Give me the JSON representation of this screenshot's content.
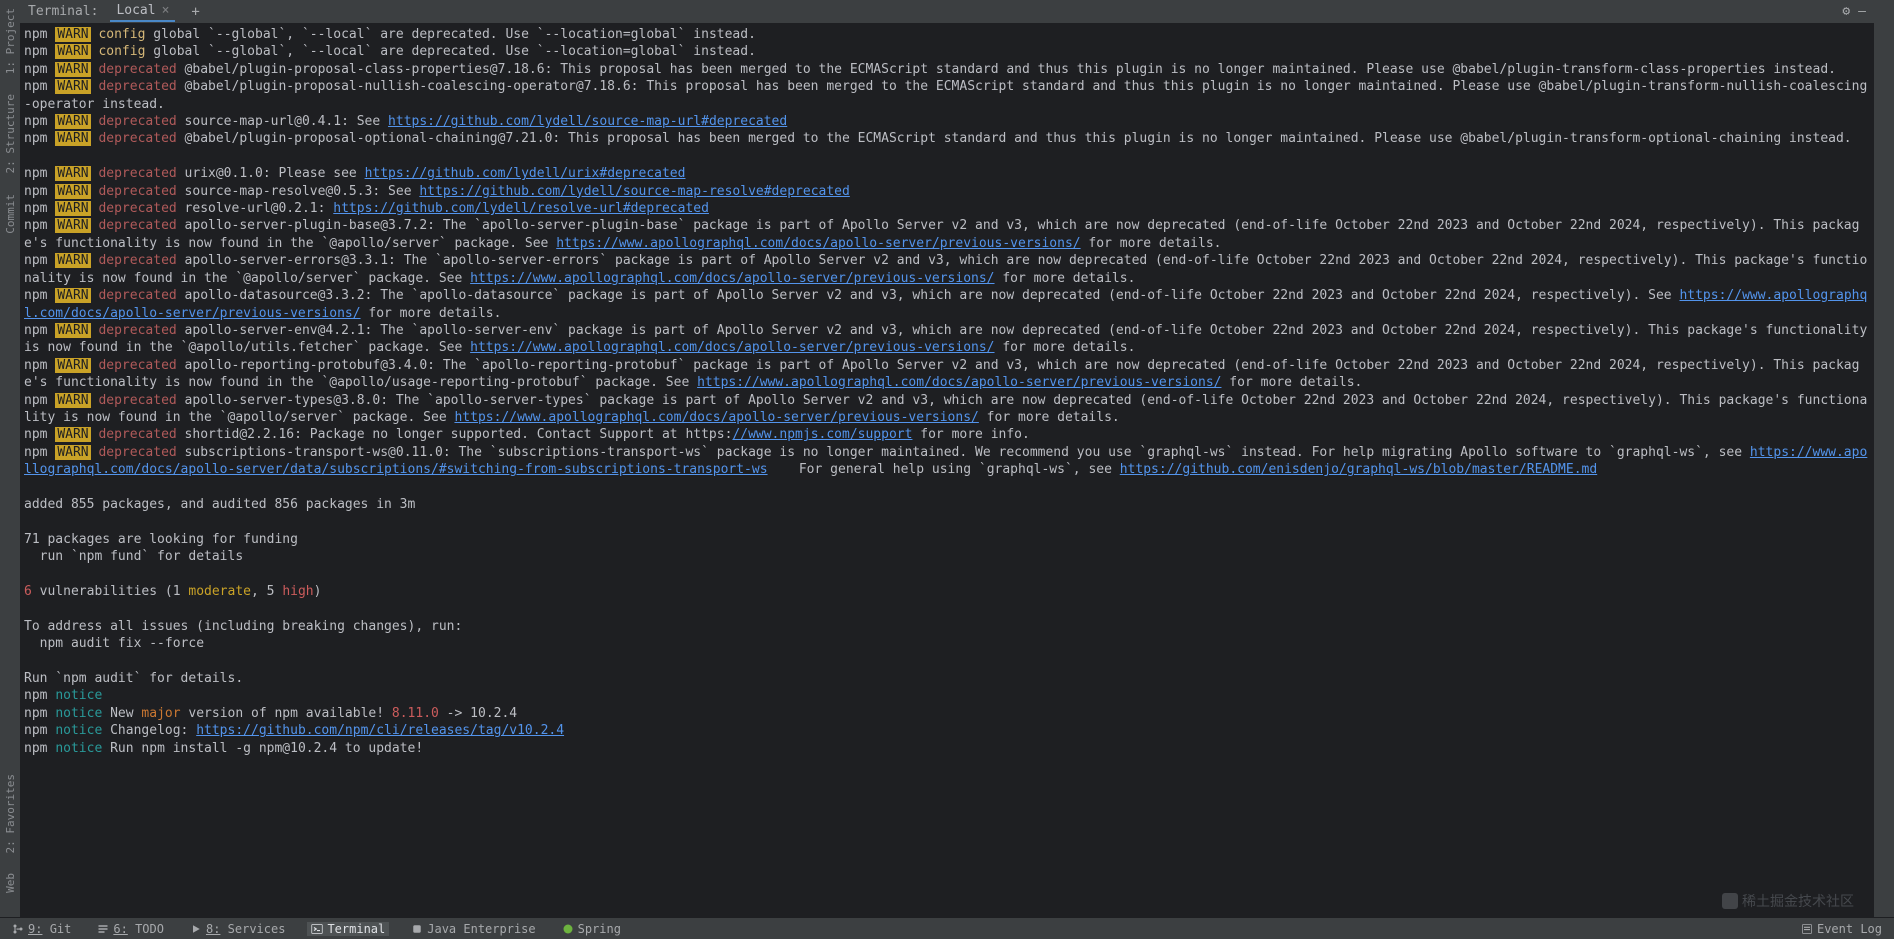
{
  "terminal": {
    "title": "Terminal:",
    "tab_label": "Local",
    "plus": "+"
  },
  "header_icons": {
    "gear": "⚙",
    "minimize": "—"
  },
  "left_gutter": {
    "project": "1: Project",
    "structure": "2: Structure",
    "commit": "Commit",
    "favorites": "2: Favorites",
    "web": "Web"
  },
  "lines": [
    [
      [
        "c-npm",
        "npm "
      ],
      [
        "c-warn-bg",
        "WARN"
      ],
      [
        "c-config",
        " config "
      ],
      [
        "",
        "global `--global`, `--local` are deprecated. Use `--location=global` instead."
      ]
    ],
    [
      [
        "c-npm",
        "npm "
      ],
      [
        "c-warn-bg",
        "WARN"
      ],
      [
        "c-config",
        " config "
      ],
      [
        "",
        "global `--global`, `--local` are deprecated. Use `--location=global` instead."
      ]
    ],
    [
      [
        "c-npm",
        "npm "
      ],
      [
        "c-warn-bg",
        "WARN"
      ],
      [
        "c-deprecated",
        " deprecated "
      ],
      [
        "",
        "@babel/plugin-proposal-class-properties@7.18.6: This proposal has been merged to the ECMAScript standard and thus this plugin is no longer maintained. Please use @babel/plugin-transform-class-properties instead."
      ]
    ],
    [
      [
        "c-npm",
        "npm "
      ],
      [
        "c-warn-bg",
        "WARN"
      ],
      [
        "c-deprecated",
        " deprecated "
      ],
      [
        "",
        "@babel/plugin-proposal-nullish-coalescing-operator@7.18.6: This proposal has been merged to the ECMAScript standard and thus this plugin is no longer maintained. Please use @babel/plugin-transform-nullish-coalescing-operator instead."
      ]
    ],
    [
      [
        "c-npm",
        "npm "
      ],
      [
        "c-warn-bg",
        "WARN"
      ],
      [
        "c-deprecated",
        " deprecated "
      ],
      [
        "",
        "source-map-url@0.4.1: See "
      ],
      [
        "link",
        "https://github.com/lydell/source-map-url#deprecated"
      ]
    ],
    [
      [
        "c-npm",
        "npm "
      ],
      [
        "c-warn-bg",
        "WARN"
      ],
      [
        "c-deprecated",
        " deprecated "
      ],
      [
        "",
        "@babel/plugin-proposal-optional-chaining@7.21.0: This proposal has been merged to the ECMAScript standard and thus this plugin is no longer maintained. Please use @babel/plugin-transform-optional-chaining instead."
      ]
    ],
    [
      [
        "",
        ""
      ]
    ],
    [
      [
        "c-npm",
        "npm "
      ],
      [
        "c-warn-bg",
        "WARN"
      ],
      [
        "c-deprecated",
        " deprecated "
      ],
      [
        "",
        "urix@0.1.0: Please see "
      ],
      [
        "link",
        "https://github.com/lydell/urix#deprecated"
      ]
    ],
    [
      [
        "c-npm",
        "npm "
      ],
      [
        "c-warn-bg",
        "WARN"
      ],
      [
        "c-deprecated",
        " deprecated "
      ],
      [
        "",
        "source-map-resolve@0.5.3: See "
      ],
      [
        "link",
        "https://github.com/lydell/source-map-resolve#deprecated"
      ]
    ],
    [
      [
        "c-npm",
        "npm "
      ],
      [
        "c-warn-bg",
        "WARN"
      ],
      [
        "c-deprecated",
        " deprecated "
      ],
      [
        "",
        "resolve-url@0.2.1: "
      ],
      [
        "link",
        "https://github.com/lydell/resolve-url#deprecated"
      ]
    ],
    [
      [
        "c-npm",
        "npm "
      ],
      [
        "c-warn-bg",
        "WARN"
      ],
      [
        "c-deprecated",
        " deprecated "
      ],
      [
        "",
        "apollo-server-plugin-base@3.7.2: The `apollo-server-plugin-base` package is part of Apollo Server v2 and v3, which are now deprecated (end-of-life October 22nd 2023 and October 22nd 2024, respectively). This package's functionality is now found in the `@apollo/server` package. See "
      ],
      [
        "link",
        "https://www.apollographql.com/docs/apollo-server/previous-versions/"
      ],
      [
        "",
        " for more details."
      ]
    ],
    [
      [
        "c-npm",
        "npm "
      ],
      [
        "c-warn-bg",
        "WARN"
      ],
      [
        "c-deprecated",
        " deprecated "
      ],
      [
        "",
        "apollo-server-errors@3.3.1: The `apollo-server-errors` package is part of Apollo Server v2 and v3, which are now deprecated (end-of-life October 22nd 2023 and October 22nd 2024, respectively). This package's functionality is now found in the `@apollo/server` package. See "
      ],
      [
        "link",
        "https://www.apollographql.com/docs/apollo-server/previous-versions/"
      ],
      [
        "",
        " for more details."
      ]
    ],
    [
      [
        "c-npm",
        "npm "
      ],
      [
        "c-warn-bg",
        "WARN"
      ],
      [
        "c-deprecated",
        " deprecated "
      ],
      [
        "",
        "apollo-datasource@3.3.2: The `apollo-datasource` package is part of Apollo Server v2 and v3, which are now deprecated (end-of-life October 22nd 2023 and October 22nd 2024, respectively). See "
      ],
      [
        "link",
        "https://www.apollographql.com/docs/apollo-server/previous-versions/"
      ],
      [
        "",
        " for more details."
      ]
    ],
    [
      [
        "c-npm",
        "npm "
      ],
      [
        "c-warn-bg",
        "WARN"
      ],
      [
        "c-deprecated",
        " deprecated "
      ],
      [
        "",
        "apollo-server-env@4.2.1: The `apollo-server-env` package is part of Apollo Server v2 and v3, which are now deprecated (end-of-life October 22nd 2023 and October 22nd 2024, respectively). This package's functionality is now found in the `@apollo/utils.fetcher` package. See "
      ],
      [
        "link",
        "https://www.apollographql.com/docs/apollo-server/previous-versions/"
      ],
      [
        "",
        " for more details."
      ]
    ],
    [
      [
        "c-npm",
        "npm "
      ],
      [
        "c-warn-bg",
        "WARN"
      ],
      [
        "c-deprecated",
        " deprecated "
      ],
      [
        "",
        "apollo-reporting-protobuf@3.4.0: The `apollo-reporting-protobuf` package is part of Apollo Server v2 and v3, which are now deprecated (end-of-life October 22nd 2023 and October 22nd 2024, respectively). This package's functionality is now found in the `@apollo/usage-reporting-protobuf` package. See "
      ],
      [
        "link",
        "https://www.apollographql.com/docs/apollo-server/previous-versions/"
      ],
      [
        "",
        " for more details."
      ]
    ],
    [
      [
        "c-npm",
        "npm "
      ],
      [
        "c-warn-bg",
        "WARN"
      ],
      [
        "c-deprecated",
        " deprecated "
      ],
      [
        "",
        "apollo-server-types@3.8.0: The `apollo-server-types` package is part of Apollo Server v2 and v3, which are now deprecated (end-of-life October 22nd 2023 and October 22nd 2024, respectively). This package's functionality is now found in the `@apollo/server` package. See "
      ],
      [
        "link",
        "https://www.apollographql.com/docs/apollo-server/previous-versions/"
      ],
      [
        "",
        " for more details."
      ]
    ],
    [
      [
        "c-npm",
        "npm "
      ],
      [
        "c-warn-bg",
        "WARN"
      ],
      [
        "c-deprecated",
        " deprecated "
      ],
      [
        "",
        "shortid@2.2.16: Package no longer supported. Contact Support at https:"
      ],
      [
        "link",
        "//www.npmjs.com/support"
      ],
      [
        "",
        " for more info."
      ]
    ],
    [
      [
        "c-npm",
        "npm "
      ],
      [
        "c-warn-bg",
        "WARN"
      ],
      [
        "c-deprecated",
        " deprecated "
      ],
      [
        "",
        "subscriptions-transport-ws@0.11.0: The `subscriptions-transport-ws` package is no longer maintained. We recommend you use `graphql-ws` instead. For help migrating Apollo software to `graphql-ws`, see "
      ],
      [
        "link",
        "https://www.apollographql.com/docs/apollo-server/data/subscriptions/#switching-from-subscriptions-transport-ws"
      ],
      [
        "",
        "    For general help using `graphql-ws`, see "
      ],
      [
        "link",
        "https://github.com/enisdenjo/graphql-ws/blob/master/README.md"
      ]
    ],
    [
      [
        "",
        ""
      ]
    ],
    [
      [
        "",
        "added 855 packages, and audited 856 packages in 3m"
      ]
    ],
    [
      [
        "",
        ""
      ]
    ],
    [
      [
        "",
        "71 packages are looking for funding"
      ]
    ],
    [
      [
        "",
        "  run `npm fund` for details"
      ]
    ],
    [
      [
        "",
        ""
      ]
    ],
    [
      [
        "c-red",
        "6 "
      ],
      [
        "",
        "vulnerabilities (1 "
      ],
      [
        "c-moderate",
        "moderate"
      ],
      [
        "",
        ", 5 "
      ],
      [
        "c-high",
        "high"
      ],
      [
        "",
        ")"
      ]
    ],
    [
      [
        "",
        ""
      ]
    ],
    [
      [
        "",
        "To address all issues (including breaking changes), run:"
      ]
    ],
    [
      [
        "",
        "  npm audit fix --force"
      ]
    ],
    [
      [
        "",
        ""
      ]
    ],
    [
      [
        "",
        "Run `npm audit` for details."
      ]
    ],
    [
      [
        "c-npm",
        "npm "
      ],
      [
        "c-notice",
        "notice"
      ]
    ],
    [
      [
        "c-npm",
        "npm "
      ],
      [
        "c-notice",
        "notice "
      ],
      [
        "",
        "New "
      ],
      [
        "c-major",
        "major"
      ],
      [
        "",
        " version of npm available! "
      ],
      [
        "c-red",
        "8.11.0"
      ],
      [
        "",
        " -> 10.2.4"
      ]
    ],
    [
      [
        "c-npm",
        "npm "
      ],
      [
        "c-notice",
        "notice "
      ],
      [
        "",
        "Changelog: "
      ],
      [
        "link",
        "https://github.com/npm/cli/releases/tag/v10.2.4"
      ]
    ],
    [
      [
        "c-npm",
        "npm "
      ],
      [
        "c-notice",
        "notice "
      ],
      [
        "",
        "Run npm install -g npm@10.2.4 to update!"
      ]
    ]
  ],
  "statusbar": {
    "git": "Git",
    "git_num": "9:",
    "todo": "TODO",
    "todo_num": "6:",
    "services": "Services",
    "services_num": "8:",
    "terminal": "Terminal",
    "java": "Java Enterprise",
    "spring": "Spring",
    "eventlog": "Event Log"
  },
  "watermark": "稀土掘金技术社区"
}
